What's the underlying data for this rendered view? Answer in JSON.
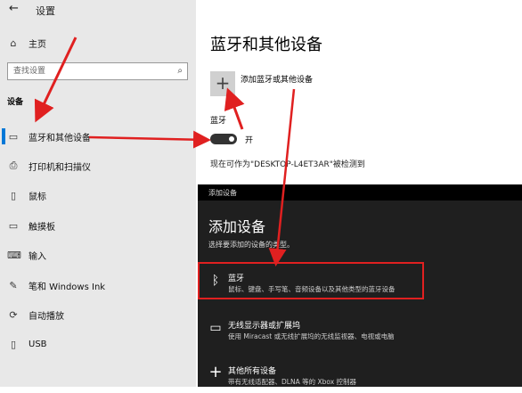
{
  "app": {
    "title": "设置",
    "back_glyph": "←"
  },
  "sidebar": {
    "home": {
      "label": "主页",
      "icon": "home-icon"
    },
    "search": {
      "placeholder": "查找设置",
      "icon": "search-icon"
    },
    "section": "设备",
    "items": [
      {
        "label": "蓝牙和其他设备",
        "icon": "bluetooth-devices-icon",
        "selected": true
      },
      {
        "label": "打印机和扫描仪",
        "icon": "printer-icon"
      },
      {
        "label": "鼠标",
        "icon": "mouse-icon"
      },
      {
        "label": "触摸板",
        "icon": "touchpad-icon"
      },
      {
        "label": "输入",
        "icon": "keyboard-icon"
      },
      {
        "label": "笔和 Windows Ink",
        "icon": "pen-icon"
      },
      {
        "label": "自动播放",
        "icon": "autoplay-icon"
      },
      {
        "label": "USB",
        "icon": "usb-icon"
      }
    ]
  },
  "main": {
    "title": "蓝牙和其他设备",
    "add_device_label": "添加蓝牙或其他设备",
    "bluetooth_label": "蓝牙",
    "toggle_state": "开",
    "discoverable": "现在可作为\"DESKTOP-L4ET3AR\"被检测到"
  },
  "dialog": {
    "titlebar": "添加设备",
    "heading": "添加设备",
    "subtitle": "选择要添加的设备的类型。",
    "options": [
      {
        "title": "蓝牙",
        "desc": "鼠标、键盘、手写笔、音频设备以及其他类型的蓝牙设备",
        "icon": "bluetooth-icon"
      },
      {
        "title": "无线显示器或扩展坞",
        "desc": "使用 Miracast 或无线扩展坞的无线监视器、电视或电脑",
        "icon": "monitor-icon"
      },
      {
        "title": "其他所有设备",
        "desc": "带有无线适配器、DLNA 等的 Xbox 控制器",
        "icon": "plus-icon"
      }
    ]
  },
  "colors": {
    "annotation": "#e02020",
    "accent": "#0078d7",
    "dialog_bg": "#1f1f1f"
  }
}
